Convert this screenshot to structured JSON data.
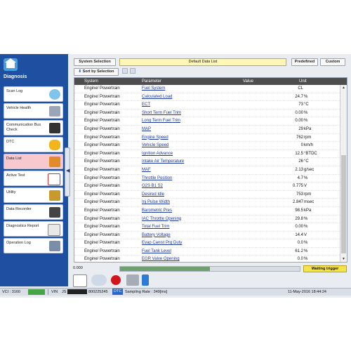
{
  "sidebar": {
    "title": "Diagnosis",
    "items": [
      {
        "label": "Scan Log",
        "icon": "magnifier-icon"
      },
      {
        "label": "Vehicle Health",
        "icon": "stethoscope-icon"
      },
      {
        "label": "Communication Bus Check",
        "icon": "car-bus-icon"
      },
      {
        "label": "DTC",
        "icon": "engine-light-icon"
      },
      {
        "label": "Data List",
        "icon": "data-list-icon"
      },
      {
        "label": "Active Test",
        "icon": "check-icon"
      },
      {
        "label": "Utility",
        "icon": "tools-icon"
      },
      {
        "label": "Data Recorder",
        "icon": "recorder-icon"
      },
      {
        "label": "Diagnostics Report",
        "icon": "report-icon"
      },
      {
        "label": "Operation Log",
        "icon": "operation-log-icon"
      }
    ]
  },
  "toolbar": {
    "system_selection": "System Selection",
    "list_title": "Default Data List",
    "predefined": "Predefined",
    "custom": "Custom",
    "sort_by": "Sort by Selection"
  },
  "table": {
    "headers": {
      "system": "System",
      "parameter": "Parameter",
      "value": "Value",
      "unit": "Unit"
    },
    "rows": [
      {
        "system": "Engine/ Powertrain",
        "parameter": "Fuel System",
        "value": "CL",
        "unit": ""
      },
      {
        "system": "Engine/ Powertrain",
        "parameter": "Calculated Load",
        "value": "24.7",
        "unit": "%"
      },
      {
        "system": "Engine/ Powertrain",
        "parameter": "ECT",
        "value": "73",
        "unit": "°C"
      },
      {
        "system": "Engine/ Powertrain",
        "parameter": "Short Term Fuel Trim",
        "value": "0.00",
        "unit": "%"
      },
      {
        "system": "Engine/ Powertrain",
        "parameter": "Long Term Fuel Trim",
        "value": "0.00",
        "unit": "%"
      },
      {
        "system": "Engine/ Powertrain",
        "parameter": "MAP",
        "value": "29",
        "unit": "kPa"
      },
      {
        "system": "Engine/ Powertrain",
        "parameter": "Engine Speed",
        "value": "762",
        "unit": "rpm"
      },
      {
        "system": "Engine/ Powertrain",
        "parameter": "Vehicle Speed",
        "value": "0",
        "unit": "km/h"
      },
      {
        "system": "Engine/ Powertrain",
        "parameter": "Ignition Advance",
        "value": "12.5",
        "unit": "°BTDC"
      },
      {
        "system": "Engine/ Powertrain",
        "parameter": "Intake Air Temperature",
        "value": "26",
        "unit": "°C"
      },
      {
        "system": "Engine/ Powertrain",
        "parameter": "MAF",
        "value": "2.13",
        "unit": "g/sec"
      },
      {
        "system": "Engine/ Powertrain",
        "parameter": "Throttle Position",
        "value": "4.7",
        "unit": "%"
      },
      {
        "system": "Engine/ Powertrain",
        "parameter": "O2S B1 S2",
        "value": "0.775",
        "unit": "V"
      },
      {
        "system": "Engine/ Powertrain",
        "parameter": "Desired Idle",
        "value": "753",
        "unit": "rpm"
      },
      {
        "system": "Engine/ Powertrain",
        "parameter": "Inj Pulse Width",
        "value": "2.847",
        "unit": "msec"
      },
      {
        "system": "Engine/ Powertrain",
        "parameter": "Barometric Pres",
        "value": "98.5",
        "unit": "kPa"
      },
      {
        "system": "Engine/ Powertrain",
        "parameter": "IAC Throttle Opening",
        "value": "29.8",
        "unit": "%"
      },
      {
        "system": "Engine/ Powertrain",
        "parameter": "Total Fuel Trim",
        "value": "0.00",
        "unit": "%"
      },
      {
        "system": "Engine/ Powertrain",
        "parameter": "Battery Voltage",
        "value": "14.4",
        "unit": "V"
      },
      {
        "system": "Engine/ Powertrain",
        "parameter": "Evap Canist Prg Duty",
        "value": "0.0",
        "unit": "%"
      },
      {
        "system": "Engine/ Powertrain",
        "parameter": "Fuel Tank Level",
        "value": "61.2",
        "unit": "%"
      },
      {
        "system": "Engine/ Powertrain",
        "parameter": "EGR Valve Opening",
        "value": "0.0",
        "unit": "%"
      }
    ]
  },
  "progress": {
    "value_text": "0.000",
    "fraction": 0.5
  },
  "trigger": "Waiting trigger",
  "statusbar": {
    "vci": "VCI : 3160",
    "vin_label": "VIN",
    "vin": "JS",
    "vin_suffix": "800225245",
    "dtc": "DTC",
    "sampling": "Sampling Rate : 349[ms]",
    "datetime": "11-May-2016 18:44:24"
  },
  "colors": {
    "sidebar": "#1e4fa1",
    "active_item": "#f7c9cf",
    "header": "#4d4d4d",
    "trigger": "#f5e34a"
  }
}
